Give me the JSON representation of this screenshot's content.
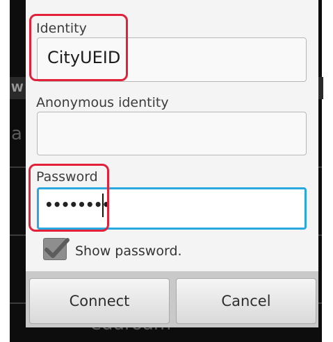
{
  "background": {
    "section_header": "W",
    "network_initial": "a",
    "network_bottom": "eduroam"
  },
  "dialog": {
    "identity_label": "Identity",
    "identity_value": "CityUEID",
    "anonymous_label": "Anonymous identity",
    "anonymous_value": "",
    "password_label": "Password",
    "password_value": "••••••••",
    "show_password_label": "Show password.",
    "show_password_checked": true,
    "connect_label": "Connect",
    "cancel_label": "Cancel"
  },
  "colors": {
    "focus_border": "#29a8e0",
    "annotation_red": "#e2203a"
  }
}
